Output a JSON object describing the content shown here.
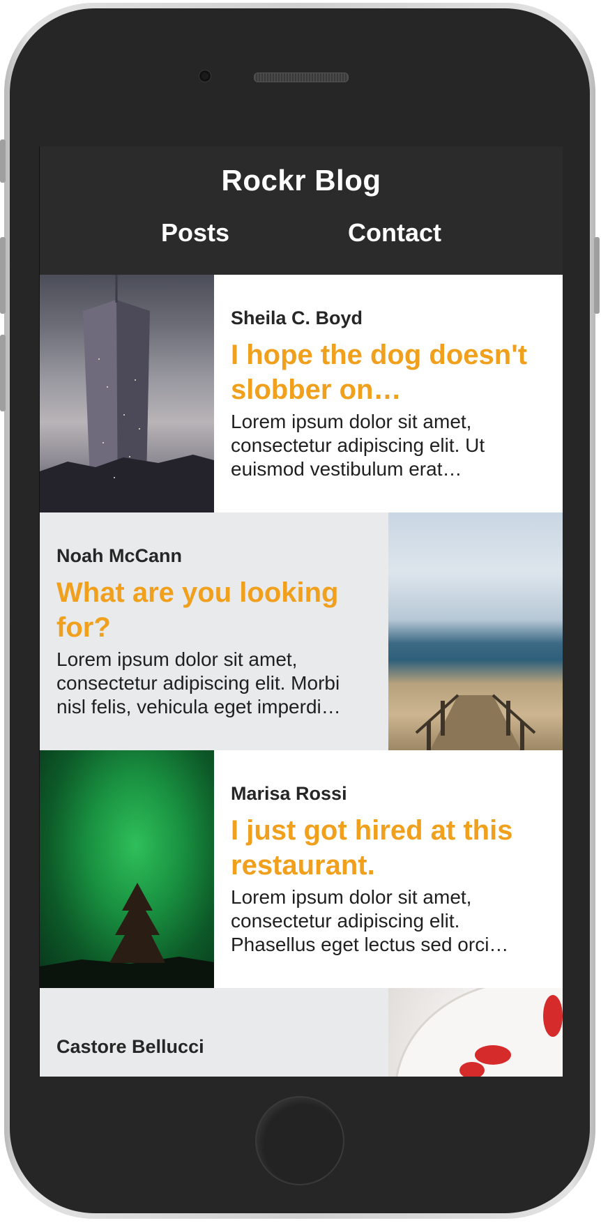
{
  "blog": {
    "title": "Rockr Blog",
    "nav": [
      {
        "label": "Posts"
      },
      {
        "label": "Contact"
      }
    ]
  },
  "posts": [
    {
      "author": "Sheila C. Boyd",
      "title": "I hope the dog doesn't slobber on…",
      "excerpt": "Lorem ipsum dolor sit amet, consectetur adipiscing elit. Ut euismod vestibulum erat…",
      "image": "skyscraper-photo",
      "image_side": "left",
      "background": "#ffffff"
    },
    {
      "author": "Noah McCann",
      "title": "What are you looking for?",
      "excerpt": "Lorem ipsum dolor sit amet, consectetur adipiscing elit. Morbi nisl felis, vehicula eget imperdi…",
      "image": "beach-photo",
      "image_side": "right",
      "background": "#e8eaeb"
    },
    {
      "author": "Marisa Rossi",
      "title": "I just got hired at this restaurant.",
      "excerpt": "Lorem ipsum dolor sit amet, consectetur adipiscing elit. Phasellus eget lectus sed orci…",
      "image": "aurora-photo",
      "image_side": "left",
      "background": "#ffffff"
    },
    {
      "author": "Castore Bellucci",
      "title": "",
      "excerpt": "",
      "image": "dessert-photo",
      "image_side": "right",
      "background": "#e8eaeb"
    }
  ],
  "colors": {
    "header_bg": "#2b2b2b",
    "accent": "#f0a01c",
    "text": "#1f1f1f",
    "alt_row": "#e8eaeb"
  }
}
